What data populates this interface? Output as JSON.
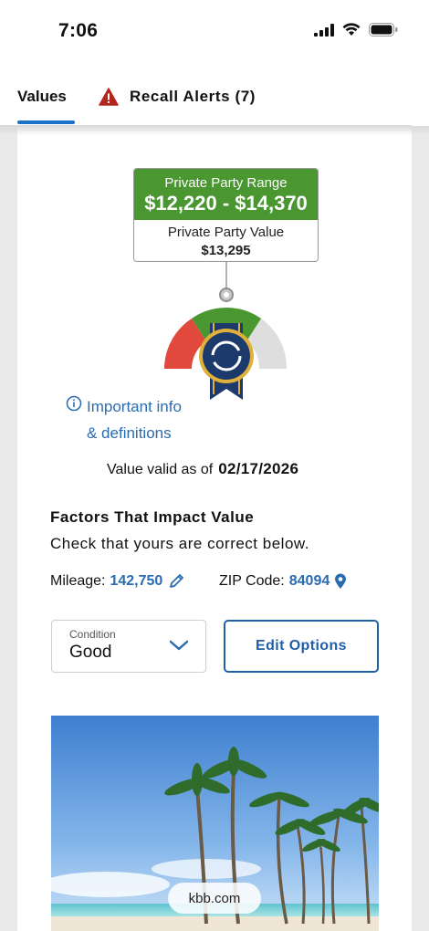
{
  "status_bar": {
    "time": "7:06"
  },
  "tabs": {
    "values_label": "Values",
    "recall_label": "Recall Alerts (7)"
  },
  "valuation": {
    "range_label": "Private Party Range",
    "range_amount": "$12,220 - $14,370",
    "value_label": "Private Party Value",
    "value_amount": "$13,295"
  },
  "info_link": {
    "line1": "Important info",
    "line2": "& definitions"
  },
  "valid": {
    "prefix": "Value valid as of",
    "date": "02/17/2026"
  },
  "factors": {
    "title": "Factors That Impact Value",
    "subtitle": "Check that yours are correct below.",
    "mileage_label": "Mileage:",
    "mileage_value": "142,750",
    "zip_label": "ZIP Code:",
    "zip_value": "84094"
  },
  "condition": {
    "label": "Condition",
    "value": "Good"
  },
  "edit_options_label": "Edit Options",
  "ad": {
    "pill_text": "kbb.com"
  },
  "colors": {
    "accent_blue": "#2b6cb0",
    "range_green": "#4a9631",
    "gauge_red": "#e0493c",
    "gauge_gray": "#dedede",
    "badge_navy": "#1c3a6b",
    "alert_red": "#b3261e"
  },
  "icons": [
    "signal-icon",
    "wifi-icon",
    "battery-icon",
    "alert-triangle-icon",
    "info-icon",
    "pencil-icon",
    "location-pin-icon",
    "chevron-down-icon",
    "kbb-badge-icon"
  ]
}
